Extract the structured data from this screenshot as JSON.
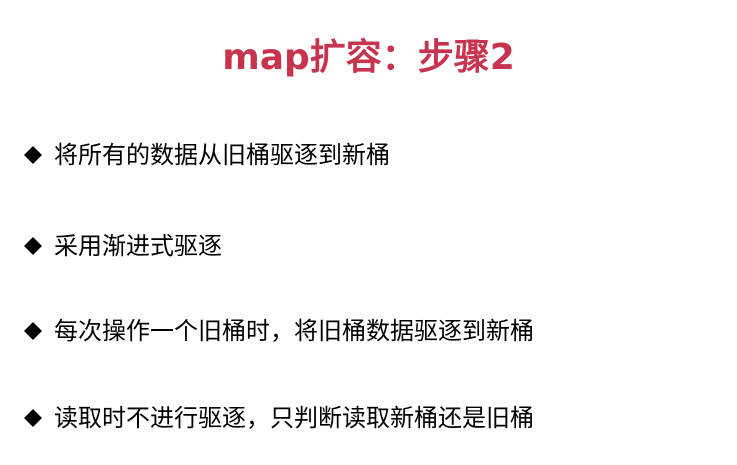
{
  "colors": {
    "title": "#c7344e",
    "text": "#000000",
    "background": "#ffffff"
  },
  "slide": {
    "title": "map扩容：步骤2",
    "bullets": [
      {
        "icon": "diamond-bullet-icon",
        "text": "将所有的数据从旧桶驱逐到新桶"
      },
      {
        "icon": "diamond-bullet-icon",
        "text": "采用渐进式驱逐"
      },
      {
        "icon": "diamond-bullet-icon",
        "text": "每次操作一个旧桶时，将旧桶数据驱逐到新桶"
      },
      {
        "icon": "diamond-bullet-icon",
        "text": "读取时不进行驱逐，只判断读取新桶还是旧桶"
      }
    ]
  }
}
